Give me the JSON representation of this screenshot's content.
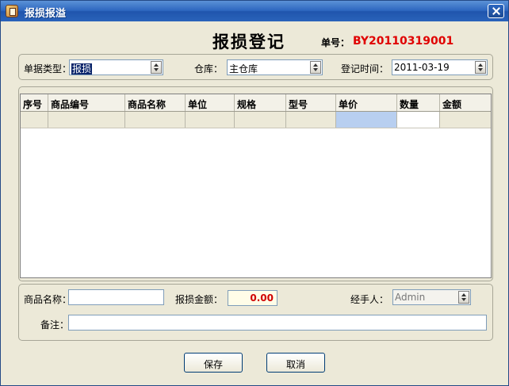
{
  "window": {
    "title": "报损报溢",
    "icon": "stock-adjustment-icon",
    "close_icon": "close-icon"
  },
  "header": {
    "title": "报损登记",
    "order_no_label": "单号：",
    "order_no": "BY20110319001"
  },
  "form_top": {
    "doc_type_label": "单据类型：",
    "doc_type_value": "报损",
    "warehouse_label": "仓库：",
    "warehouse_value": "主仓库",
    "date_label": "登记时间：",
    "date_value": "2011-03-19"
  },
  "table": {
    "columns": [
      "序号",
      "商品编号",
      "商品名称",
      "单位",
      "规格",
      "型号",
      "单价",
      "数量",
      "金额"
    ],
    "rows": [
      [
        "",
        "",
        "",
        "",
        "",
        "",
        "",
        "",
        ""
      ]
    ]
  },
  "form_bottom": {
    "product_name_label": "商品名称：",
    "product_name_value": "",
    "loss_amount_label": "报损金额：",
    "loss_amount_value": "0.00",
    "handler_label": "经手人：",
    "handler_value": "Admin",
    "note_label": "备注：",
    "note_value": ""
  },
  "buttons": {
    "save": "保存",
    "cancel": "取消"
  },
  "colors": {
    "title_bar": "#2d66bf",
    "order_no": "#e00000",
    "selected_cell": "#b8cff0",
    "amount": "#d00000"
  }
}
